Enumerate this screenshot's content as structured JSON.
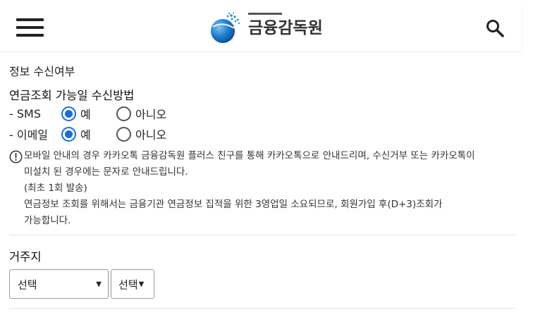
{
  "header": {
    "logo_text": "금융감독원"
  },
  "info": {
    "section_title": "정보 수신여부",
    "sub_title": "연금조회 가능일 수신방법",
    "options": [
      {
        "label": "- SMS",
        "yes": "예",
        "no": "아니오",
        "selected": "yes"
      },
      {
        "label": "- 이메일",
        "yes": "예",
        "no": "아니오",
        "selected": "yes"
      }
    ],
    "notice_lines": [
      "모바일 안내의 경우 카카오톡 금융감독원 플러스 친구를 통해 카카오톡으로 안내드리며, 수신거부 또는 카카오톡이",
      "미설치 된 경우에는 문자로 안내드립니다.",
      "(최초 1회 발송)",
      "연금정보 조회를 위해서는 금융기관 연금정보 집적을 위한 3영업일 소요되므로, 회원가입 후(D+3)조회가",
      "가능합니다."
    ]
  },
  "residence": {
    "title": "거주지",
    "select1_value": "선택",
    "select2_value": "선택"
  },
  "colors": {
    "accent": "#1a6fd6",
    "text": "#222222",
    "divider": "#e2e2e2"
  }
}
